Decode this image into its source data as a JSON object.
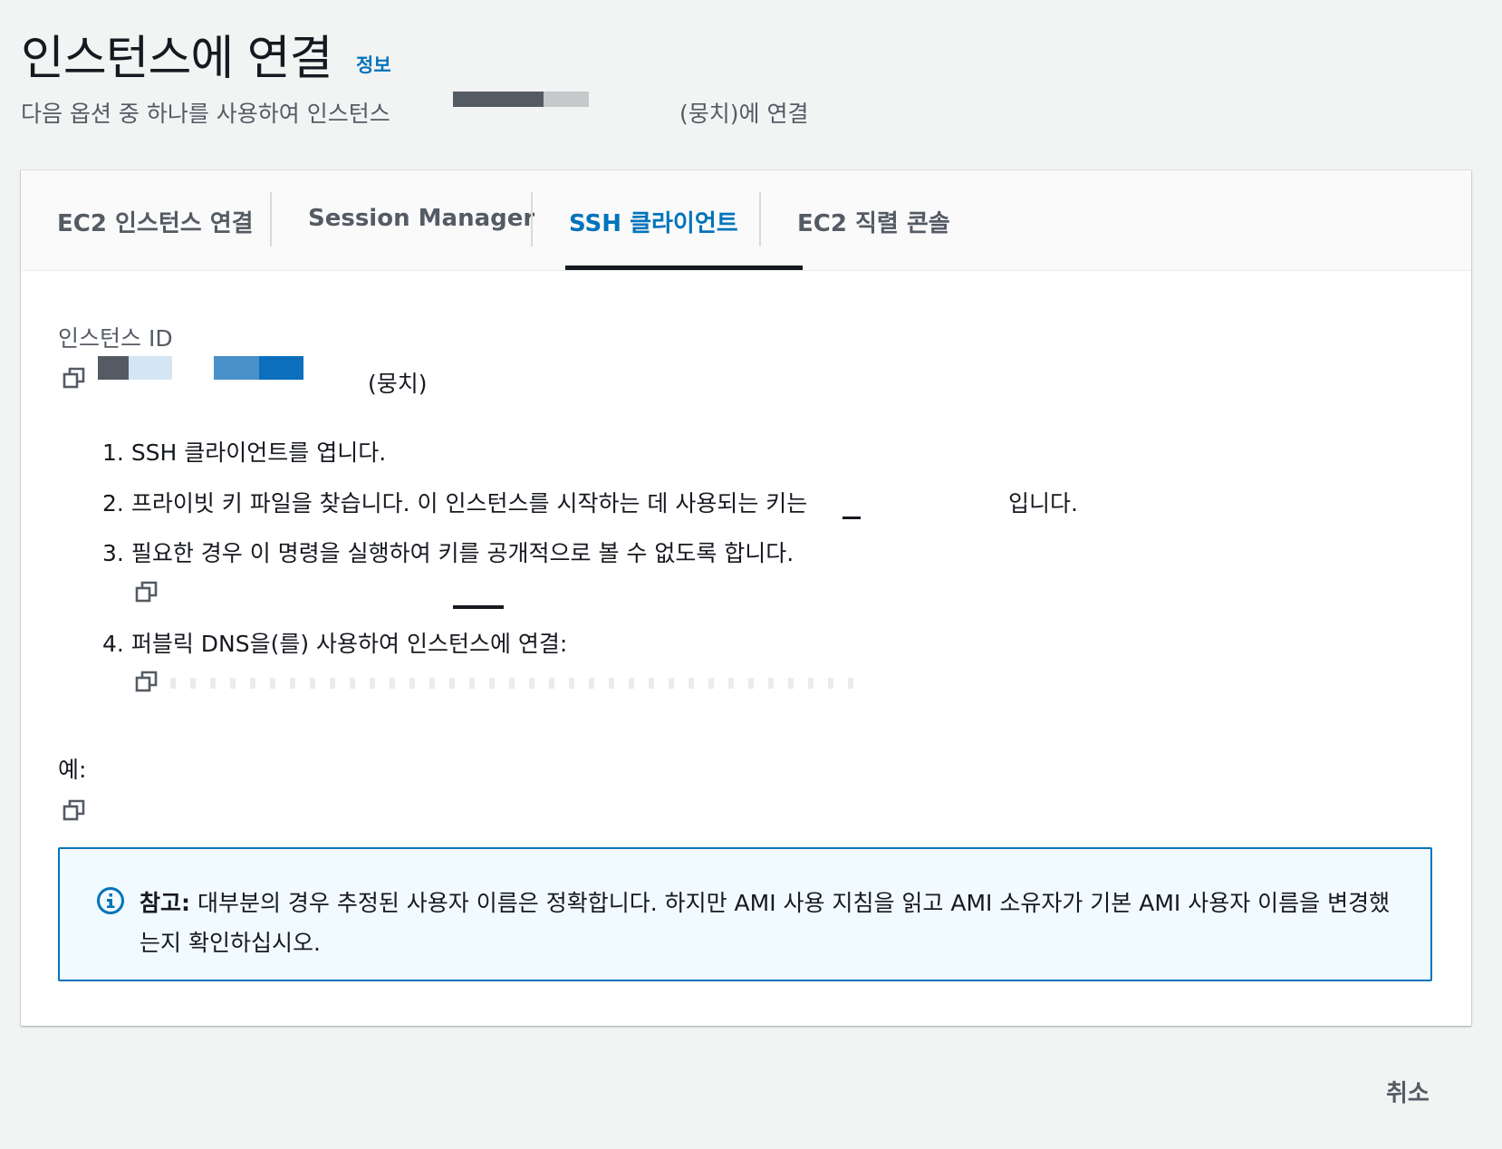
{
  "header": {
    "title": "인스턴스에 연결",
    "info_link": "정보",
    "subtitle_prefix": "다음 옵션 중 하나를 사용하여 인스턴스",
    "subtitle_suffix": "(뭉치)에 연결"
  },
  "tabs": [
    {
      "label": "EC2 인스턴스 연결",
      "active": false
    },
    {
      "label": "Session Manager",
      "active": false
    },
    {
      "label": "SSH 클라이언트",
      "active": true
    },
    {
      "label": "EC2 직렬 콘솔",
      "active": false
    }
  ],
  "instance": {
    "label": "인스턴스 ID",
    "name_suffix": "(뭉치)"
  },
  "steps": [
    {
      "number": "1.",
      "text": "SSH 클라이언트를 엽니다."
    },
    {
      "number": "2.",
      "text": "프라이빗 키 파일을 찾습니다. 이 인스턴스를 시작하는 데 사용되는 키는",
      "suffix": "입니다."
    },
    {
      "number": "3.",
      "text": "필요한 경우 이 명령을 실행하여 키를 공개적으로 볼 수 없도록 합니다."
    },
    {
      "number": "4.",
      "text": "퍼블릭 DNS을(를) 사용하여 인스턴스에 연결:"
    }
  ],
  "example": {
    "label": "예:"
  },
  "note": {
    "label": "참고:",
    "text": "대부분의 경우 추정된 사용자 이름은 정확합니다. 하지만 AMI 사용 지침을 읽고 AMI 소유자가 기본 AMI 사용자 이름을 변경했는지 확인하십시오."
  },
  "footer": {
    "cancel_label": "취소"
  },
  "colors": {
    "accent": "#0073bb",
    "text": "#16191f",
    "muted": "#545b64",
    "note_bg": "#f1faff"
  },
  "icons": {
    "copy": "copy-icon",
    "info": "info-circle-icon"
  }
}
